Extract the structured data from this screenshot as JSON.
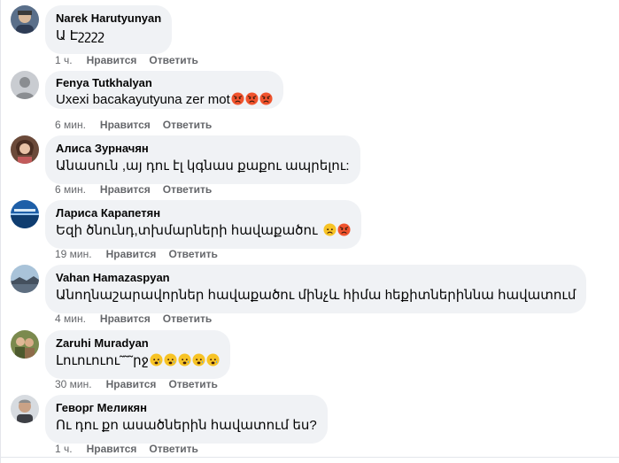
{
  "actions": {
    "like_label": "Нравится",
    "reply_label": "Ответить"
  },
  "comments": [
    {
      "author": "Narek Harutyunyan",
      "text": "Ա Էշշշշ",
      "time": "1 ч.",
      "emojis": []
    },
    {
      "author": "Fenya Tutkhalyan",
      "text": "Uxexi bacakayutyuna zer mot",
      "time": "6 мин.",
      "emojis": [
        "angry-emoji",
        "angry-emoji",
        "angry-emoji"
      ]
    },
    {
      "author": "Алиса Зурначян",
      "text": "Անասուն ,այ դու էլ կգնաս քաքու ապրելու:",
      "time": "6 мин.",
      "emojis": []
    },
    {
      "author": "Лариса Карапетян",
      "text": "Եզի ծնունդ,տխմարների հավաքածու",
      "time": "19 мин.",
      "emojis": [
        "frowning-emoji",
        "angry-emoji"
      ]
    },
    {
      "author": "Vahan Hamazaspyan",
      "text": "Անողնաշարավորներ հավաքածու մինչև հիմա hեքիտներիննա հավատում",
      "time": "4 мин.",
      "emojis": []
    },
    {
      "author": "Zaruhi Muradyan",
      "text": "Լուուուու˜˜˜րջ",
      "time": "30 мин.",
      "emojis": [
        "sad-emoji",
        "sad-emoji",
        "sad-emoji",
        "sad-emoji",
        "sad-emoji"
      ]
    },
    {
      "author": "Геворг Меликян",
      "text": "Ու դու քո ասածներին հավատում ես?",
      "time": "1 ч.",
      "emojis": []
    }
  ]
}
